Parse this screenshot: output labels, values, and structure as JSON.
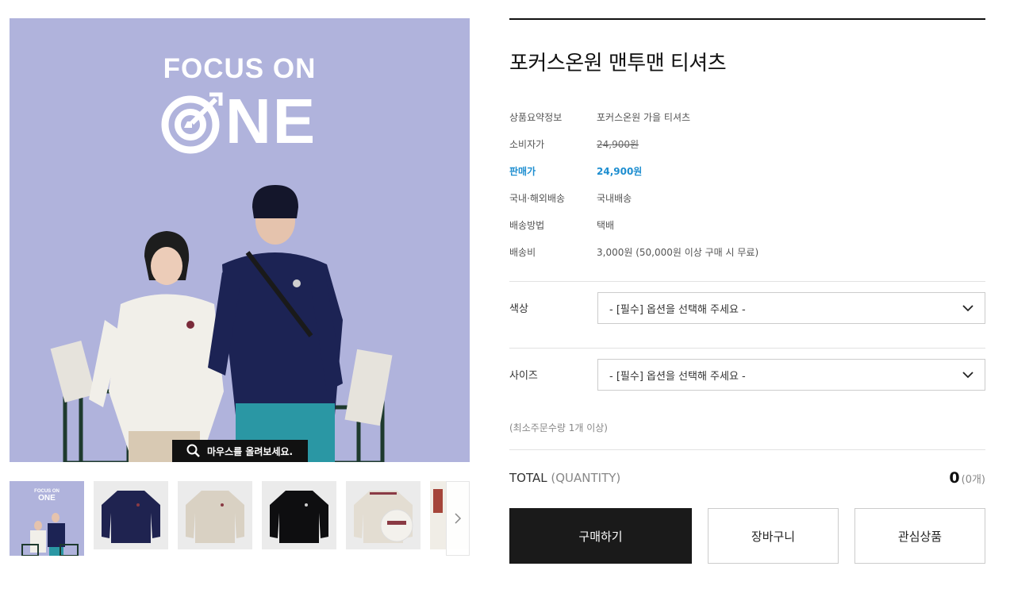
{
  "gallery": {
    "logo_line1": "FOCUS ON",
    "logo_line2": "NE",
    "zoom_hint": "마우스를 올려보세요.",
    "next_icon": "chevron-right-icon",
    "background_color": "#b0b3dc"
  },
  "product": {
    "title": "포커스온원 맨투맨 티셔츠",
    "specs": [
      {
        "label": "상품요약정보",
        "value": "포커스온원 가을 티셔츠"
      },
      {
        "label": "소비자가",
        "value": "24,900원"
      },
      {
        "label": "판매가",
        "value": "24,900원"
      },
      {
        "label": "국내·해외배송",
        "value": "국내배송"
      },
      {
        "label": "배송방법",
        "value": "택배"
      },
      {
        "label": "배송비",
        "value": "3,000원 (50,000원 이상 구매 시 무료)"
      }
    ],
    "price_color": "#1e8ed0"
  },
  "options": [
    {
      "label": "색상",
      "placeholder": "- [필수] 옵션을 선택해 주세요 -"
    },
    {
      "label": "사이즈",
      "placeholder": "- [필수] 옵션을 선택해 주세요 -"
    }
  ],
  "min_order": "(최소주문수량 1개 이상)",
  "total": {
    "label": "TOTAL",
    "quantity_label": "(QUANTITY)",
    "amount": "0",
    "count": "(0개)"
  },
  "buttons": {
    "buy": "구매하기",
    "cart": "장바구니",
    "wish": "관심상품"
  }
}
